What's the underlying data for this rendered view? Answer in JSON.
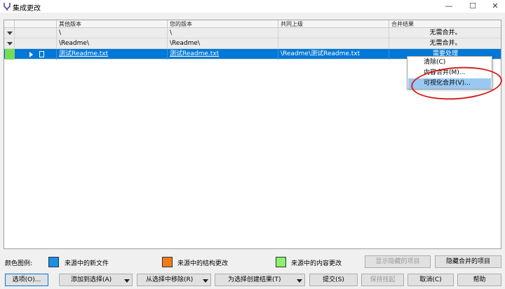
{
  "window": {
    "title": "集成更改",
    "icon": "merge-app-icon",
    "controls": {
      "minimize": "—",
      "maximize": "☐",
      "close": "✕"
    }
  },
  "grid": {
    "columns": [
      "",
      "",
      "其他版本",
      "您的版本",
      "共同上级",
      "合并结果"
    ],
    "rows": [
      {
        "other": "\\",
        "yours": "\\",
        "ancestor": "",
        "result": "无需合并。"
      },
      {
        "other": "\\Readme\\",
        "yours": "\\Readme\\",
        "ancestor": "",
        "result": "无需合并。"
      },
      {
        "other": "测试Readme.txt",
        "yours": "测试Readme.txt",
        "ancestor": "\\Readme\\测试Readme.txt",
        "result": "需要处理"
      }
    ]
  },
  "context_menu": {
    "items": [
      "清除(C)",
      "内容合并(M)...",
      "可视化合并(V)..."
    ],
    "highlighted_index": 2
  },
  "legend": {
    "label": "颜色图例:",
    "items": [
      {
        "text": "来源中的新文件",
        "color": "#1a8fe8"
      },
      {
        "text": "来源中的结构更改",
        "color": "#f07c1b"
      },
      {
        "text": "来源中的内容更改",
        "color": "#8df06a"
      }
    ],
    "show_hidden": "显示隐藏的项目",
    "hide_merged": "隐藏合并的项目"
  },
  "buttons": {
    "options": "选项(O)...",
    "add_to_selection": "添加到选择(A)",
    "remove_from_selection": "从选择中移除(R)",
    "create_result": "为选择创建结果(T)",
    "submit": "提交(S)",
    "keep_pending": "保持挂起",
    "cancel": "取消(C)",
    "help": "帮助"
  },
  "colors": {
    "selection": "#0078d7",
    "annotation": "#d42020",
    "menu_highlight": "#99c9f3"
  }
}
